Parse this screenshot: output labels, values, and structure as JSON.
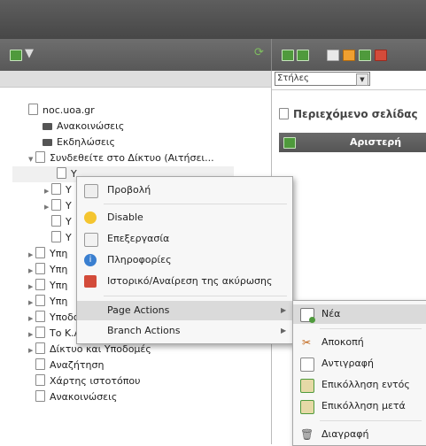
{
  "right_panel": {
    "columns_select": "Στήλες",
    "content_title": "Περιεχόμενο σελίδας",
    "left_column": "Αριστερή"
  },
  "tree": [
    "noc.uoa.gr",
    "Ανακοινώσεις",
    "Εκδηλώσεις",
    "Συνδεθείτε στο Δίκτυο (Αιτήσει...",
    "Y",
    "Y",
    "Y",
    "Y",
    "Y",
    "Υπη",
    "Υπη",
    "Υπη",
    "Υπη",
    "Υποδομής Ηλεκτρ...",
    "Το Κ.ΛΕΙ.ΔΙ.",
    "Δίκτυο και Υποδομές",
    "Αναζήτηση",
    "Χάρτης ιστοτόπου",
    "Ανακοινώσεις"
  ],
  "context_menu": {
    "view": "Προβολή",
    "disable": "Disable",
    "edit": "Επεξεργασία",
    "info": "Πληροφορίες",
    "history": "Ιστορικό/Αναίρεση της ακύρωσης",
    "page_actions": "Page Actions",
    "branch_actions": "Branch Actions"
  },
  "submenu": {
    "new": "Νέα",
    "cut": "Αποκοπή",
    "copy": "Αντιγραφή",
    "paste_into": "Επικόλληση εντός",
    "paste_after": "Επικόλληση μετά",
    "delete": "Διαγραφή"
  },
  "colors": {
    "toolbar": "#5e5e5e",
    "accent_green": "#4f9a3c",
    "menu_highlight": "#dadada"
  }
}
